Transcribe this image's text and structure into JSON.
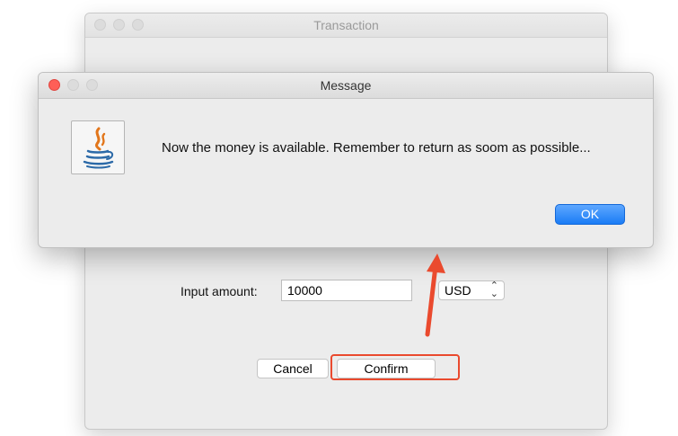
{
  "transaction_window": {
    "title": "Transaction",
    "amount_label": "Input amount:",
    "amount_value": "10000",
    "currency_selected": "USD",
    "cancel_label": "Cancel",
    "confirm_label": "Confirm"
  },
  "message_dialog": {
    "title": "Message",
    "text": "Now the money is available. Remember to return as soom as possible...",
    "ok_label": "OK",
    "icon": "java-coffee-cup-icon"
  },
  "colors": {
    "annotation_red": "#ea4a2e",
    "ok_blue": "#1a7cf5",
    "close_red": "#fe5f57"
  }
}
